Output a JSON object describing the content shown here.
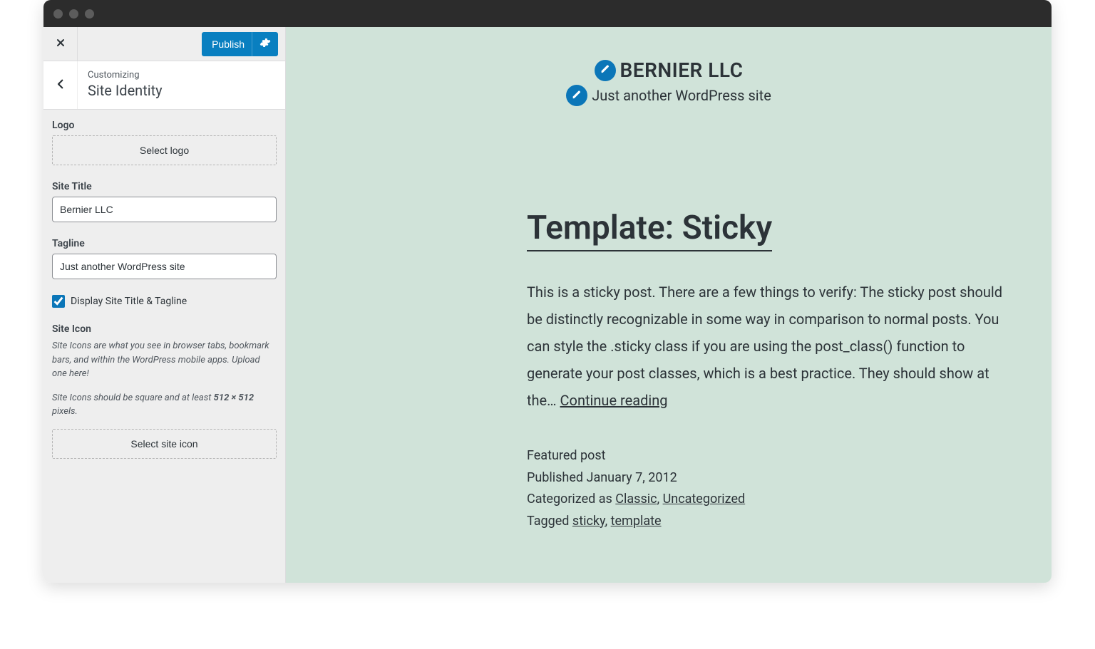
{
  "toolbar": {
    "publish_label": "Publish"
  },
  "panel": {
    "customizing_label": "Customizing",
    "section_title": "Site Identity",
    "logo_label": "Logo",
    "select_logo_label": "Select logo",
    "site_title_label": "Site Title",
    "site_title_value": "Bernier LLC",
    "tagline_label": "Tagline",
    "tagline_value": "Just another WordPress site",
    "display_title_tagline_label": "Display Site Title & Tagline",
    "display_title_tagline_checked": true,
    "site_icon_label": "Site Icon",
    "site_icon_desc_1": "Site Icons are what you see in browser tabs, bookmark bars, and within the WordPress mobile apps. Upload one here!",
    "site_icon_desc_2a": "Site Icons should be square and at least ",
    "site_icon_desc_2b": "512 × 512",
    "site_icon_desc_2c": " pixels.",
    "select_site_icon_label": "Select site icon"
  },
  "preview": {
    "site_title": "BERNIER LLC",
    "site_tagline": "Just another WordPress site",
    "post_title": "Template: Sticky",
    "post_excerpt": "This is a sticky post. There are a few things to verify: The sticky post should be distinctly recognizable in some way in comparison to normal posts. You can style the .sticky class if you are using the post_class() function to generate your post classes, which is a best practice. They should show at the… ",
    "continue_reading": "Continue reading",
    "meta_featured": "Featured post",
    "meta_published_prefix": "Published ",
    "meta_published_date": "January 7, 2012",
    "meta_categorized_prefix": "Categorized as ",
    "meta_cat_1": "Classic",
    "meta_cat_sep": ", ",
    "meta_cat_2": "Uncategorized",
    "meta_tagged_prefix": "Tagged ",
    "meta_tag_1": "sticky",
    "meta_tag_sep": ", ",
    "meta_tag_2": "template"
  }
}
